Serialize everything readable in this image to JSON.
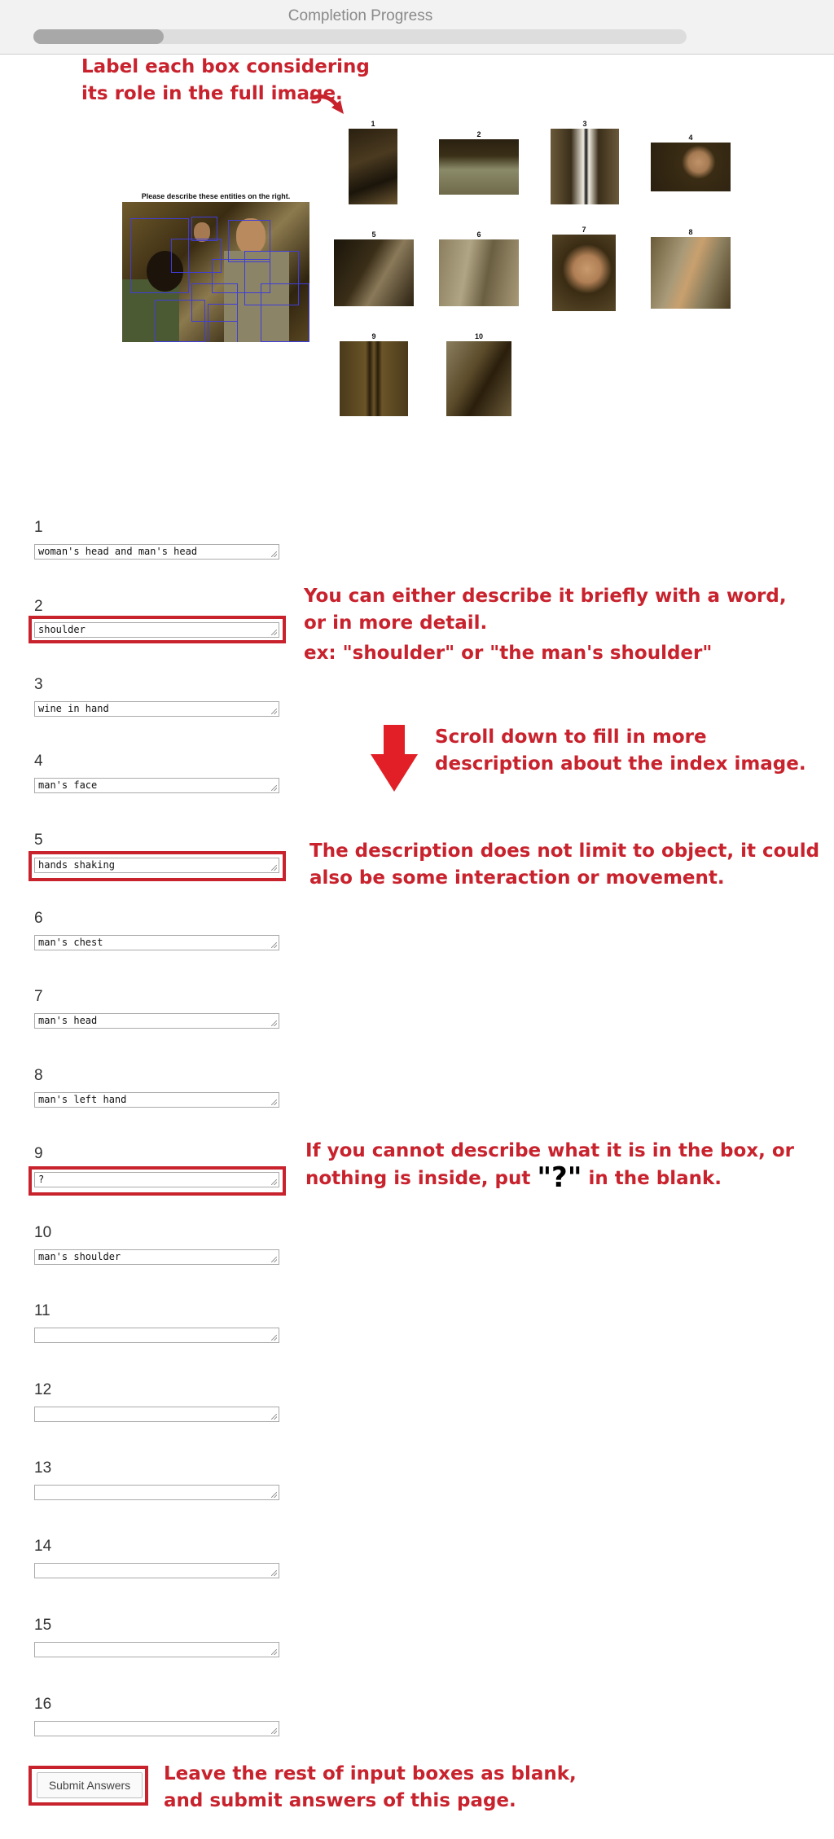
{
  "header": {
    "title": "Completion Progress",
    "progress_percent": 20
  },
  "annotations": {
    "label_each_box": [
      "Label each box considering",
      "its role in the full image."
    ],
    "describe_briefly": [
      "You can either describe it briefly with a word,",
      "or in more detail."
    ],
    "example": "ex: \"shoulder\" or \"the man's shoulder\"",
    "scroll_down": [
      "Scroll down to fill in more",
      "description about the index image."
    ],
    "interaction": [
      "The description does not limit to object, it could",
      "also be some interaction or movement."
    ],
    "cannot_describe_line1": "If you cannot describe what it is in the box, or",
    "cannot_describe_line2_pre": "nothing is inside, put ",
    "cannot_describe_q": "\"?\"",
    "cannot_describe_line2_post": " in the blank.",
    "leave_rest": [
      "Leave the rest of input boxes as blank,",
      "and submit answers of this page."
    ]
  },
  "index_image": {
    "caption": "Please describe these entities on the right."
  },
  "crops": [
    "1",
    "2",
    "3",
    "4",
    "5",
    "6",
    "7",
    "8",
    "9",
    "10"
  ],
  "fields": [
    {
      "label": "1",
      "value": "woman's head and man's head"
    },
    {
      "label": "2",
      "value": "shoulder"
    },
    {
      "label": "3",
      "value": "wine in hand"
    },
    {
      "label": "4",
      "value": "man's face"
    },
    {
      "label": "5",
      "value": "hands shaking"
    },
    {
      "label": "6",
      "value": "man's chest"
    },
    {
      "label": "7",
      "value": "man's head"
    },
    {
      "label": "8",
      "value": "man's left hand"
    },
    {
      "label": "9",
      "value": "?"
    },
    {
      "label": "10",
      "value": "man's shoulder"
    },
    {
      "label": "11",
      "value": ""
    },
    {
      "label": "12",
      "value": ""
    },
    {
      "label": "13",
      "value": ""
    },
    {
      "label": "14",
      "value": ""
    },
    {
      "label": "15",
      "value": ""
    },
    {
      "label": "16",
      "value": ""
    }
  ],
  "submit": {
    "label": "Submit Answers"
  },
  "colors": {
    "annotation_red": "#c8222d",
    "bbox_blue": "#3f3dd8"
  }
}
